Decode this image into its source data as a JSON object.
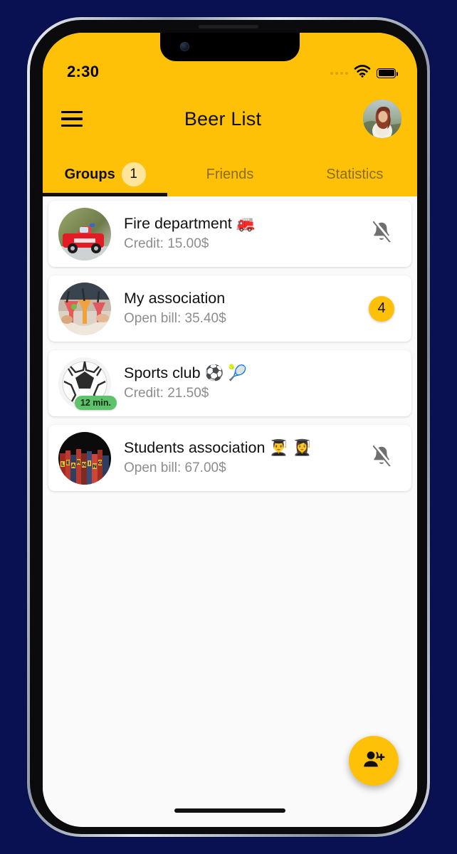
{
  "background_color": "#0a1152",
  "theme": {
    "accent": "#FFC107",
    "badge_soft": "#FFE59B",
    "online_green": "#5EC26A",
    "text_muted": "#8d8d8d"
  },
  "status_bar": {
    "time": "2:30",
    "signal_icon": "signal-dots-icon",
    "wifi_icon": "wifi-icon",
    "battery_icon": "battery-full-icon"
  },
  "app_bar": {
    "menu_icon": "hamburger-menu-icon",
    "title": "Beer List",
    "avatar_alt": "user-profile-photo"
  },
  "tabs": [
    {
      "label": "Groups",
      "badge": "1",
      "active": true
    },
    {
      "label": "Friends",
      "badge": null,
      "active": false
    },
    {
      "label": "Statistics",
      "badge": null,
      "active": false
    }
  ],
  "groups": [
    {
      "title": "Fire department 🚒",
      "subtitle": "Credit: 15.00$",
      "avatar": "fire-truck-photo",
      "right_icon": "bell-off-icon",
      "badge": null,
      "time_pill": null
    },
    {
      "title": "My association",
      "subtitle": "Open bill: 35.40$",
      "avatar": "cheers-drinks-photo",
      "right_icon": null,
      "badge": "4",
      "time_pill": null
    },
    {
      "title": "Sports club ⚽ 🎾",
      "subtitle": "Credit: 21.50$",
      "avatar": "soccer-ball-photo",
      "right_icon": null,
      "badge": null,
      "time_pill": "12 min."
    },
    {
      "title": "Students association 👨‍🎓 👩‍🎓",
      "subtitle": "Open bill: 67.00$",
      "avatar": "learning-books-photo",
      "right_icon": "bell-off-icon",
      "badge": null,
      "time_pill": null
    }
  ],
  "fab": {
    "icon": "person-add-icon",
    "label": ""
  }
}
